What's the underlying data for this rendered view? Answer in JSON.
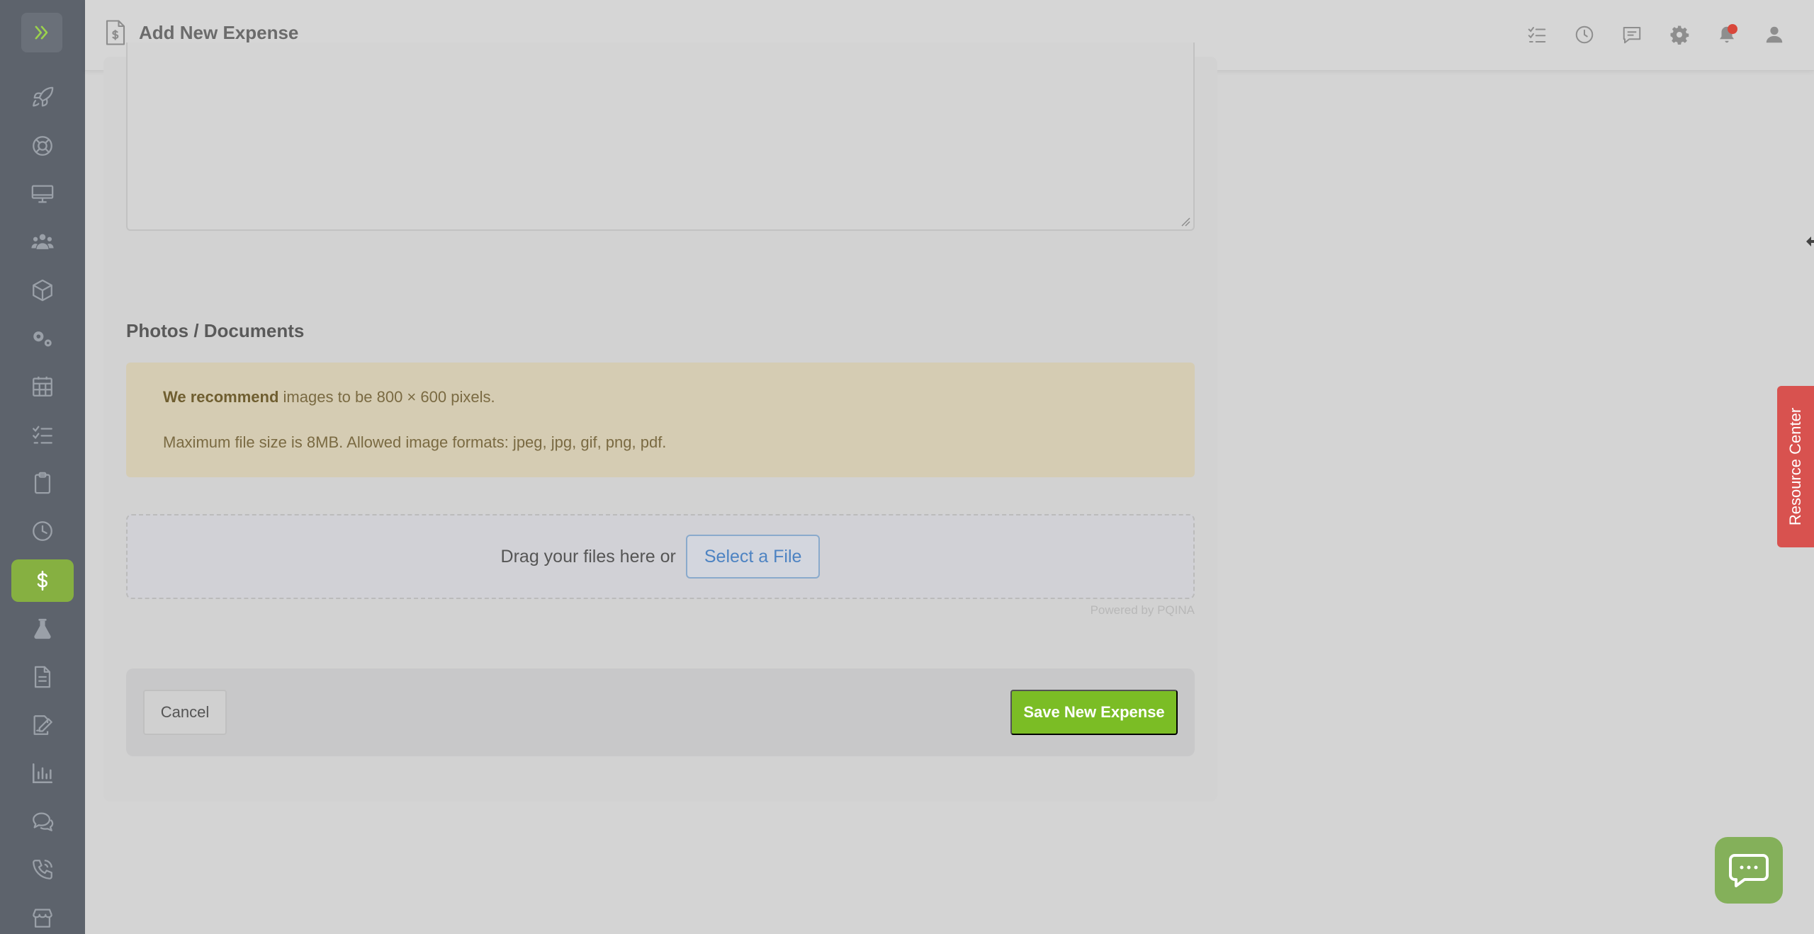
{
  "header": {
    "title": "Add New Expense"
  },
  "sidebar": {
    "items": [
      {
        "name": "rocket-icon"
      },
      {
        "name": "lifebuoy-icon"
      },
      {
        "name": "monitor-icon"
      },
      {
        "name": "users-icon"
      },
      {
        "name": "box-icon"
      },
      {
        "name": "gears-icon"
      },
      {
        "name": "calendar-icon"
      },
      {
        "name": "task-list-icon"
      },
      {
        "name": "clipboard-icon"
      },
      {
        "name": "clock-icon"
      },
      {
        "name": "dollar-icon",
        "active": true
      },
      {
        "name": "flask-icon"
      },
      {
        "name": "document-icon"
      },
      {
        "name": "signature-icon"
      },
      {
        "name": "chart-icon"
      },
      {
        "name": "chat-icon"
      },
      {
        "name": "phone-icon"
      },
      {
        "name": "store-icon"
      }
    ]
  },
  "photos": {
    "section_title": "Photos / Documents",
    "recommend_bold": "We recommend",
    "recommend_rest": " images to be 800 × 600 pixels.",
    "limits": "Maximum file size is 8MB. Allowed image formats: jpeg, jpg, gif, png, pdf.",
    "drag_text": "Drag your files here or",
    "select_label": "Select a File",
    "powered_by": "Powered by PQINA"
  },
  "actions": {
    "cancel_label": "Cancel",
    "save_label": "Save New Expense"
  },
  "resource_center": {
    "label": "Resource Center"
  },
  "colors": {
    "sidebar": "#5d636c",
    "active": "#86b041",
    "save": "#7bbd25",
    "resource": "#d8524f"
  }
}
